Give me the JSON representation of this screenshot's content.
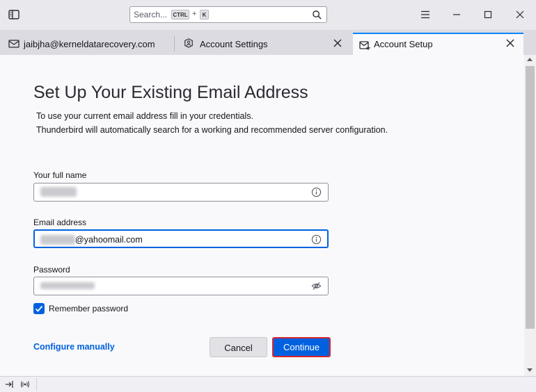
{
  "search": {
    "placeholder": "Search...",
    "key1": "CTRL",
    "plus": "+",
    "key2": "K"
  },
  "tabs": [
    {
      "label": "jaibjha@kerneldatarecovery.com",
      "icon": "mail-icon"
    },
    {
      "label": "Account Settings",
      "icon": "account-settings-icon"
    },
    {
      "label": "Account Setup",
      "icon": "mail-plus-icon"
    }
  ],
  "page": {
    "title": "Set Up Your Existing Email Address",
    "description_line1": "To use your current email address fill in your credentials.",
    "description_line2": "Thunderbird will automatically search for a working and recommended server configuration."
  },
  "form": {
    "name_label": "Your full name",
    "email_label": "Email address",
    "email_domain": "@yahoomail.com",
    "password_label": "Password",
    "remember_label": "Remember password",
    "remember_checked": true
  },
  "actions": {
    "configure_manually": "Configure manually",
    "cancel": "Cancel",
    "continue": "Continue"
  },
  "colors": {
    "accent": "#0061e0",
    "highlight_border": "#d7262f",
    "active_tab_indicator": "#0a84ff"
  }
}
